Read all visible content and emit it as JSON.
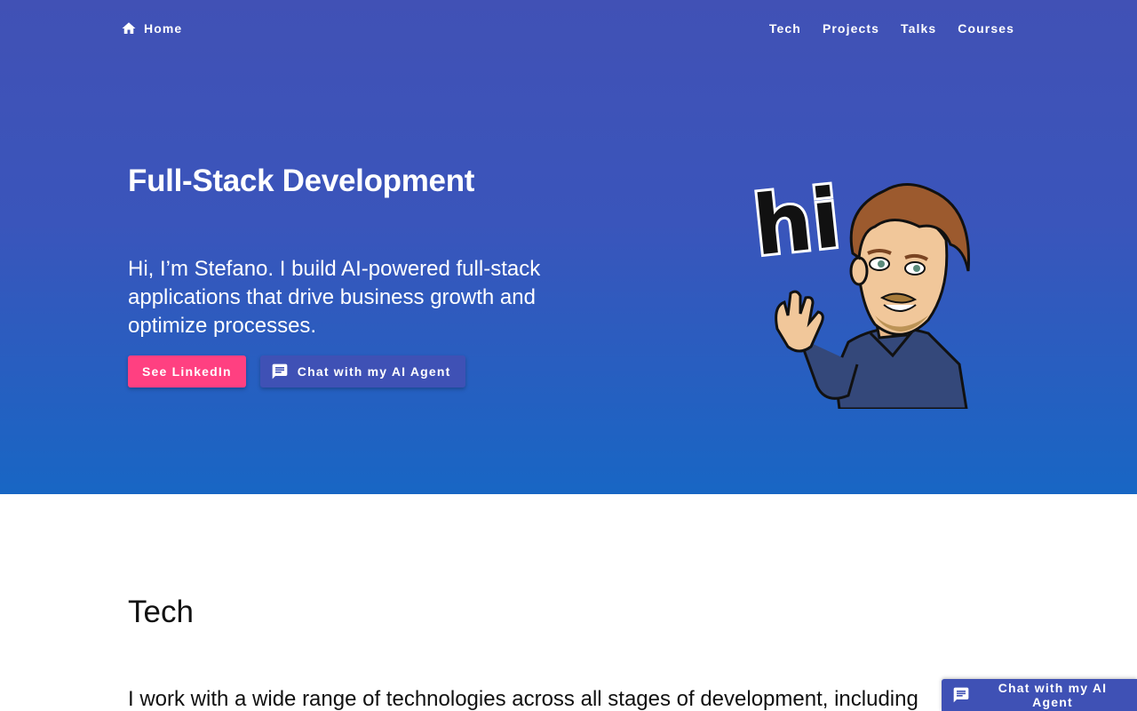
{
  "nav": {
    "home_label": "Home",
    "home_icon": "home-icon",
    "links": [
      {
        "label": "Tech"
      },
      {
        "label": "Projects"
      },
      {
        "label": "Talks"
      },
      {
        "label": "Courses"
      }
    ]
  },
  "hero": {
    "title": "Full-Stack Development",
    "lead": "Hi, I’m Stefano. I build AI-powered full-stack applications that drive business growth and optimize processes.",
    "primary_button": "See LinkedIn",
    "secondary_button": "Chat with my AI Agent",
    "secondary_icon": "chat-icon",
    "avatar_text": "hi"
  },
  "tech": {
    "title": "Tech",
    "text": "I work with a wide range of technologies across all stages of development, including"
  },
  "floating_chat": {
    "label": "Chat with my AI Agent",
    "icon": "chat-icon"
  },
  "colors": {
    "hero_top": "#4151b5",
    "hero_bottom": "#1866c4",
    "accent_pink": "#ff4081",
    "indigo": "#3f51b5"
  }
}
